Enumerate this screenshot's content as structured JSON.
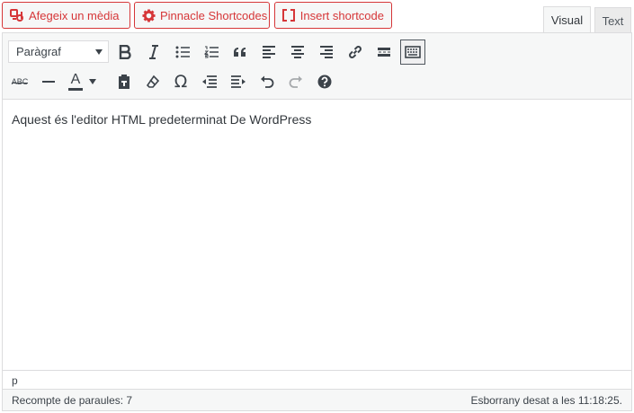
{
  "media_buttons": [
    {
      "label": "Afegeix un mèdia",
      "icon": "add-media-icon"
    },
    {
      "label": "Pinnacle Shortcodes",
      "icon": "gear-icon"
    },
    {
      "label": "Insert shortcode",
      "icon": "brackets-icon"
    }
  ],
  "tabs": {
    "visual": "Visual",
    "text": "Text"
  },
  "toolbar": {
    "format_select": "Paràgraf",
    "row1_icons": [
      "bold-icon",
      "italic-icon",
      "bulleted-list-icon",
      "numbered-list-icon",
      "blockquote-icon",
      "align-left-icon",
      "align-center-icon",
      "align-right-icon",
      "link-icon",
      "read-more-icon",
      "toolbar-toggle-icon"
    ],
    "row2_icons": [
      "strikethrough-icon",
      "horizontal-line-icon",
      "text-color-icon",
      "paste-as-text-icon",
      "clear-formatting-icon",
      "special-character-icon",
      "outdent-icon",
      "indent-icon",
      "undo-icon",
      "redo-icon",
      "help-icon"
    ],
    "strike_label": "ABC",
    "text_color_letter": "A"
  },
  "content": {
    "text": "Aquest és l'editor HTML predeterminat De WordPress"
  },
  "path": "p",
  "status": {
    "word_count": "Recompte de paraules: 7",
    "draft_saved": "Esborrany desat a les 11:18:25."
  },
  "colors": {
    "accent": "#d63638",
    "toolbar_bg": "#f6f7f7",
    "border": "#dcdcde"
  }
}
